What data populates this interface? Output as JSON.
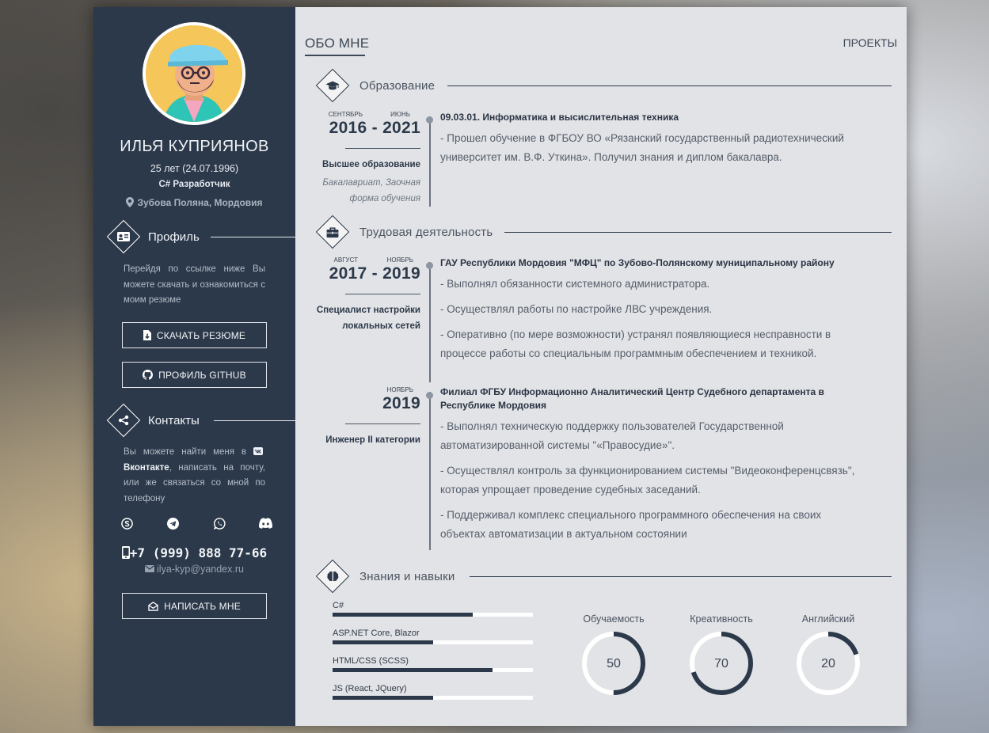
{
  "profile": {
    "name": "ИЛЬЯ КУПРИЯНОВ",
    "age": "25 лет (24.07.1996)",
    "role": "C# Разработчик",
    "location": "Зубова Поляна, Мордовия"
  },
  "sidebar": {
    "profile_heading": "Профиль",
    "profile_text": "Перейдя по ссылке ниже Вы можете скачать и ознакомиться с моим резюме",
    "download_button": "СКАЧАТЬ РЕЗЮМЕ",
    "github_button": "ПРОФИЛЬ GITHUB",
    "contacts_heading": "Контакты",
    "contacts_text_before": "Вы можете найти меня в ",
    "contacts_link": "Вконтакте",
    "contacts_text_after": ", написать на почту, или же связаться со мной по телефону",
    "socials": [
      "skype-icon",
      "telegram-icon",
      "whatsapp-icon",
      "discord-icon"
    ],
    "phone": "+7 (999) 888 77-66",
    "email": "ilya-kyp@yandex.ru",
    "write_button": "НАПИСАТЬ МНЕ"
  },
  "tabs": {
    "about": "ОБО МНЕ",
    "projects": "ПРОЕКТЫ"
  },
  "education": {
    "heading": "Образование",
    "entries": [
      {
        "month_start": "СЕНТЯБРЬ",
        "month_end": "ИЮНЬ",
        "years": "2016 - 2021",
        "degree": "Высшее образование",
        "form_line1": "Бакалавриат, Заочная",
        "form_line2": "форма обучения",
        "title": "09.03.01. Информатика и высислительная техника",
        "text": "- Прошел обучение в ФГБОУ ВО «Рязанский государственный радиотехнический университет им. В.Ф. Уткина». Получил знания и диплом бакалавра."
      }
    ]
  },
  "work": {
    "heading": "Трудовая деятельность",
    "entries": [
      {
        "month_start": "АВГУСТ",
        "month_end": "НОЯБРЬ",
        "years": "2017 - 2019",
        "position_line1": "Специалист настройки",
        "position_line2": "локальных сетей",
        "title": "ГАУ Республики Мордовия \"МФЦ\" по Зубово-Полянскому муниципальному району",
        "items": [
          "- Выполнял обязанности системного администратора.",
          "- Осуществлял работы по настройке ЛВС учреждения.",
          "- Оперативно (по мере возможности) устранял появляющиеся несправности в процессе работы со специальным программным обеспечением и техникой."
        ]
      },
      {
        "month_end": "НОЯБРЬ",
        "years": "2019",
        "position_line1": "Инженер II категории",
        "title": "Филиал ФГБУ Информационно Аналитический Центр Судебного департамента в Республике Мордовия",
        "items": [
          "- Выполнял техническую поддержку пользователей Государственной автоматизированной системы \"«Правосудие»\".",
          "- Осуществлял контроль за функционированием системы \"Видеоконференцсвязь\", которая упрощает проведение судебных заседаний.",
          "- Поддерживал комплекс специального программного обеспечения на своих объектах автоматизации в актуальном состоянии"
        ]
      }
    ]
  },
  "skills": {
    "heading": "Знания и навыки",
    "bars": [
      {
        "label": "C#",
        "percent": 70
      },
      {
        "label": "ASP.NET Core, Blazor",
        "percent": 50
      },
      {
        "label": "HTML/CSS (SCSS)",
        "percent": 80
      },
      {
        "label": "JS (React, JQuery)",
        "percent": 50
      }
    ],
    "gauges": [
      {
        "label": "Обучаемость",
        "value": "50",
        "percent": 50
      },
      {
        "label": "Креативность",
        "value": "70",
        "percent": 70
      },
      {
        "label": "Английский",
        "value": "20",
        "percent": 20
      }
    ]
  },
  "colors": {
    "sidebar": "#2c394a",
    "main": "#e2e3e6",
    "accent": "#2c394a"
  }
}
